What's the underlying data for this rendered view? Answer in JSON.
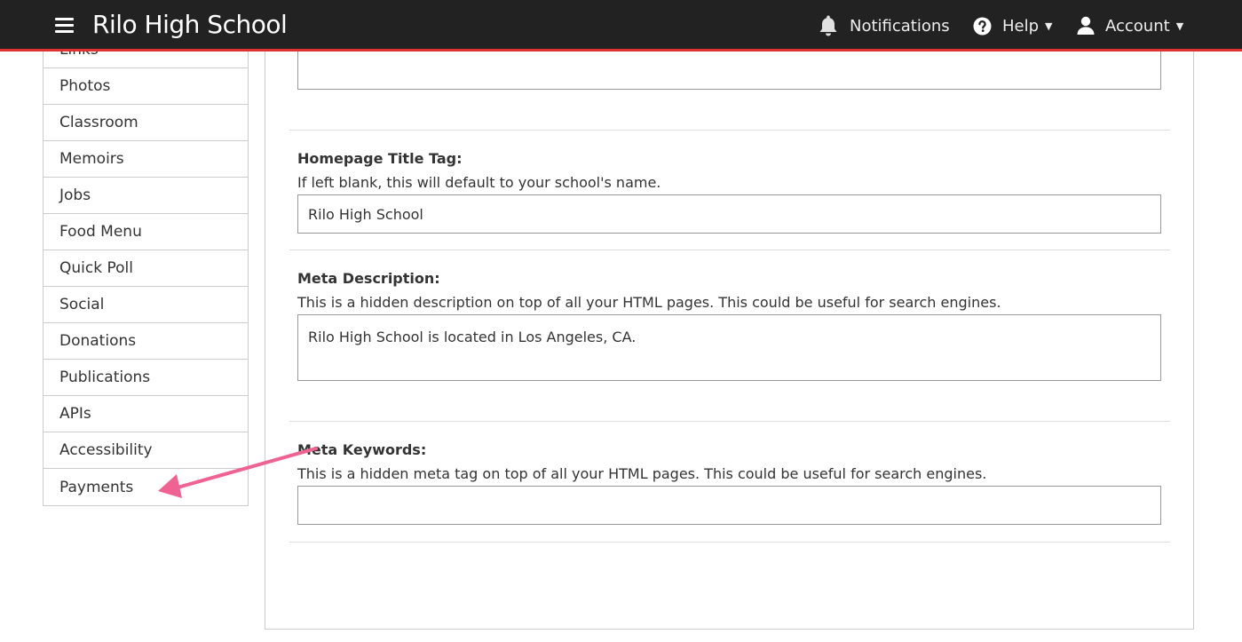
{
  "header": {
    "title": "Rilo High School",
    "notifications_label": "Notifications",
    "help_label": "Help",
    "account_label": "Account",
    "bar_color": "#222222",
    "accent_color": "#e03232"
  },
  "sidebar": {
    "items": [
      {
        "label": "Links"
      },
      {
        "label": "Photos"
      },
      {
        "label": "Classroom"
      },
      {
        "label": "Memoirs"
      },
      {
        "label": "Jobs"
      },
      {
        "label": "Food Menu"
      },
      {
        "label": "Quick Poll"
      },
      {
        "label": "Social"
      },
      {
        "label": "Donations"
      },
      {
        "label": "Publications"
      },
      {
        "label": "APIs"
      },
      {
        "label": "Accessibility"
      },
      {
        "label": "Payments"
      }
    ]
  },
  "form": {
    "title_tag": {
      "label": "Homepage Title Tag:",
      "help": "If left blank, this will default to your school's name.",
      "value": "Rilo High School"
    },
    "meta_description": {
      "label": "Meta Description:",
      "help": "This is a hidden description on top of all your HTML pages. This could be useful for search engines.",
      "value": "Rilo High School is located in Los Angeles, CA."
    },
    "meta_keywords": {
      "label": "Meta Keywords:",
      "help": "This is a hidden meta tag on top of all your HTML pages. This could be useful for search engines.",
      "value": ""
    }
  },
  "annotation": {
    "arrow_color": "#f06292",
    "target": "Payments"
  }
}
